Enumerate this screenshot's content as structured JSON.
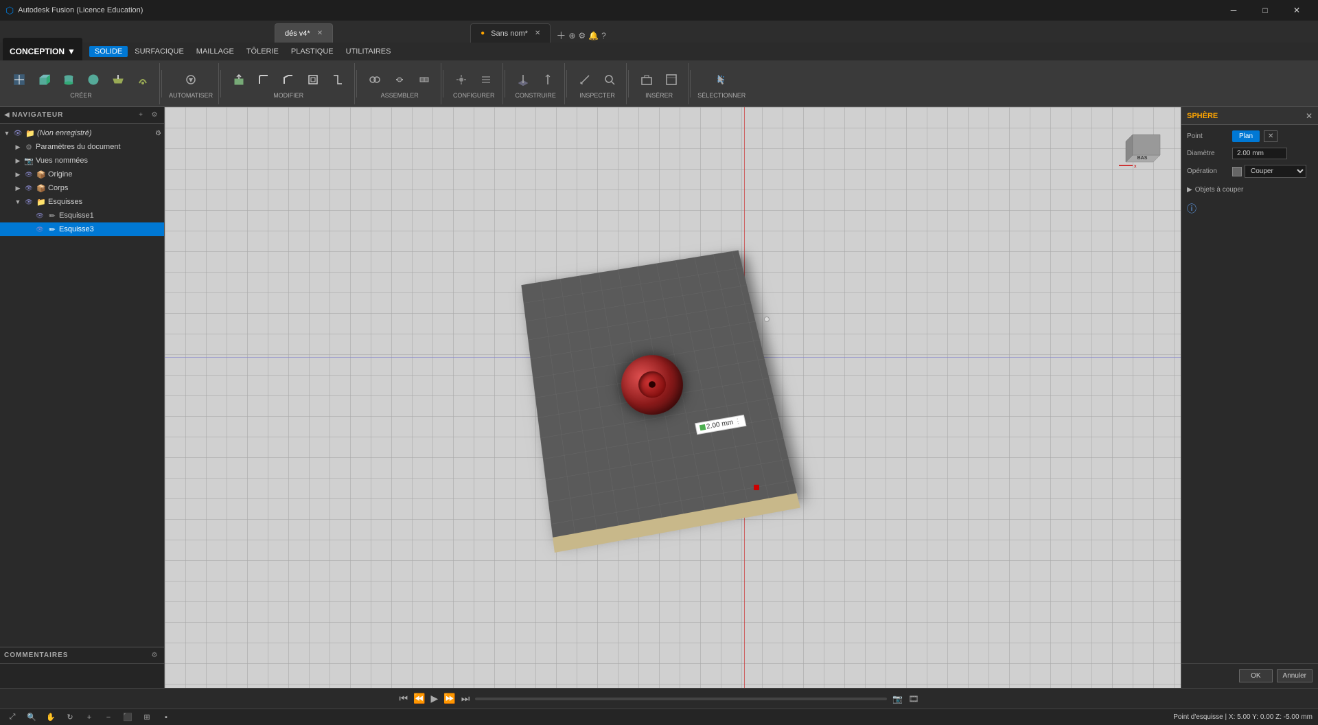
{
  "window": {
    "title": "Autodesk Fusion (Licence Education)",
    "tab1": "dés v4*",
    "tab2": "Sans nom*"
  },
  "menu": {
    "conception": "CONCEPTION",
    "items": [
      "SOLIDE",
      "SURFACIQUE",
      "MAILLAGE",
      "TÔLERIE",
      "PLASTIQUE",
      "UTILITAIRES"
    ]
  },
  "toolbar": {
    "creer": "CRÉER",
    "automatiser": "AUTOMATISER",
    "modifier": "MODIFIER",
    "assembler": "ASSEMBLER",
    "configurer": "CONFIGURER",
    "construire": "CONSTRUIRE",
    "inspecter": "INSPECTER",
    "inserer": "INSÉRER",
    "selectionner": "SÉLECTIONNER"
  },
  "navigator": {
    "title": "NAVIGATEUR",
    "items": [
      {
        "label": "(Non enregistré)",
        "level": 0,
        "expanded": true,
        "type": "doc"
      },
      {
        "label": "Paramètres du document",
        "level": 1,
        "type": "settings"
      },
      {
        "label": "Vues nommées",
        "level": 1,
        "type": "views"
      },
      {
        "label": "Origine",
        "level": 1,
        "type": "origin"
      },
      {
        "label": "Corps",
        "level": 1,
        "type": "body"
      },
      {
        "label": "Esquisses",
        "level": 1,
        "expanded": true,
        "type": "sketches"
      },
      {
        "label": "Esquisse1",
        "level": 2,
        "type": "sketch"
      },
      {
        "label": "Esquisse3",
        "level": 2,
        "type": "sketch",
        "active": true
      }
    ]
  },
  "comments": {
    "title": "COMMENTAIRES"
  },
  "sphere_panel": {
    "title": "SPHÈRE",
    "point_label": "Point",
    "point_value": "Plan",
    "diametre_label": "Diamètre",
    "diametre_value": "2.00 mm",
    "operation_label": "Opération",
    "operation_value": "Couper",
    "objets_label": "Objets à couper",
    "info_symbol": "ⓘ",
    "ok_label": "OK",
    "annuler_label": "Annuler"
  },
  "dimension": {
    "value": "2.00 mm"
  },
  "statusbar": {
    "right_text": "Point d'esquisse | X: 5.00 Y: 0.00 Z: -5.00 mm"
  },
  "orientation": {
    "label": "BAS"
  }
}
